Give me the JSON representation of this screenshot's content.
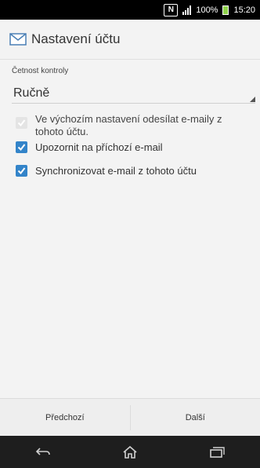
{
  "status_bar": {
    "nfc_label": "N",
    "battery": "100%",
    "time": "15:20"
  },
  "header": {
    "title": "Nastavení účtu"
  },
  "check_frequency": {
    "label": "Četnost kontroly",
    "value": "Ručně"
  },
  "options": [
    {
      "label": "Ve výchozím nastavení odesílat e-maily z tohoto účtu.",
      "checked": false,
      "enabled": false
    },
    {
      "label": "Upozornit na příchozí e-mail",
      "checked": true,
      "enabled": true
    },
    {
      "label": "Synchronizovat e-mail z tohoto účtu",
      "checked": true,
      "enabled": true
    }
  ],
  "footer": {
    "prev_label": "Předchozí",
    "next_label": "Další"
  },
  "colors": {
    "accent": "#3384c9",
    "battery": "#8fd34b"
  }
}
